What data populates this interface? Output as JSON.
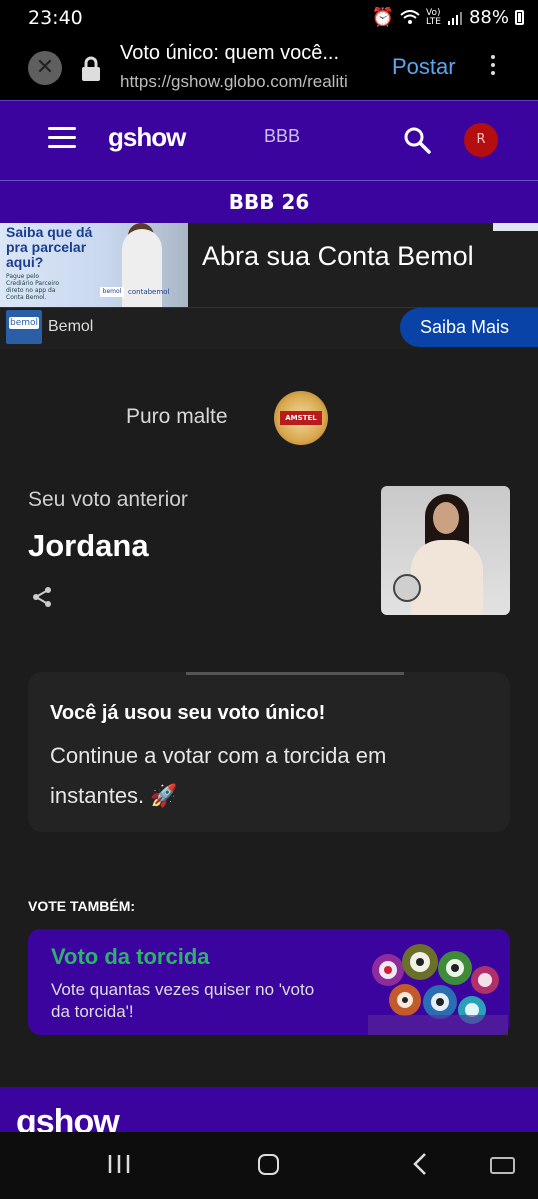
{
  "status_bar": {
    "time": "23:40",
    "battery": "88%"
  },
  "browser": {
    "page_title": "Voto único: quem você...",
    "url": "https://gshow.globo.com/realiti",
    "post_label": "Postar"
  },
  "header": {
    "logo": "gshow",
    "nav_link": "BBB",
    "avatar_initial": "R",
    "section": "BBB 26"
  },
  "ad": {
    "image_text": "Saiba que dá pra parcelar aqui?",
    "image_small_text": "Pague pelo Crediário Parceiro direto no app da Conta Bemol.",
    "image_logo1": "bemol",
    "image_logo2": "contabemol",
    "headline": "Abra sua Conta Bemol",
    "advertiser": "Bemol",
    "advertiser_logo": "bemol",
    "cta": "Saiba Mais"
  },
  "sponsor": {
    "text": "Puro malte",
    "logo_text": "AMSTEL"
  },
  "vote": {
    "previous_label": "Seu voto anterior",
    "previous_name": "Jordana",
    "notice_bold": "Você já usou seu voto único!",
    "notice_text": "Continue a votar com a torcida em instantes.",
    "notice_emoji": "🚀"
  },
  "also_vote": {
    "heading": "VOTE TAMBÉM:",
    "title": "Voto da torcida",
    "description": "Vote quantas vezes quiser no 'voto da torcida'!"
  },
  "footer": {
    "logo": "gshow"
  },
  "colors": {
    "purple": "#3c049e",
    "green": "#2eb16b",
    "link_blue": "#5aa7f0",
    "cta_blue": "#0a43a8"
  }
}
